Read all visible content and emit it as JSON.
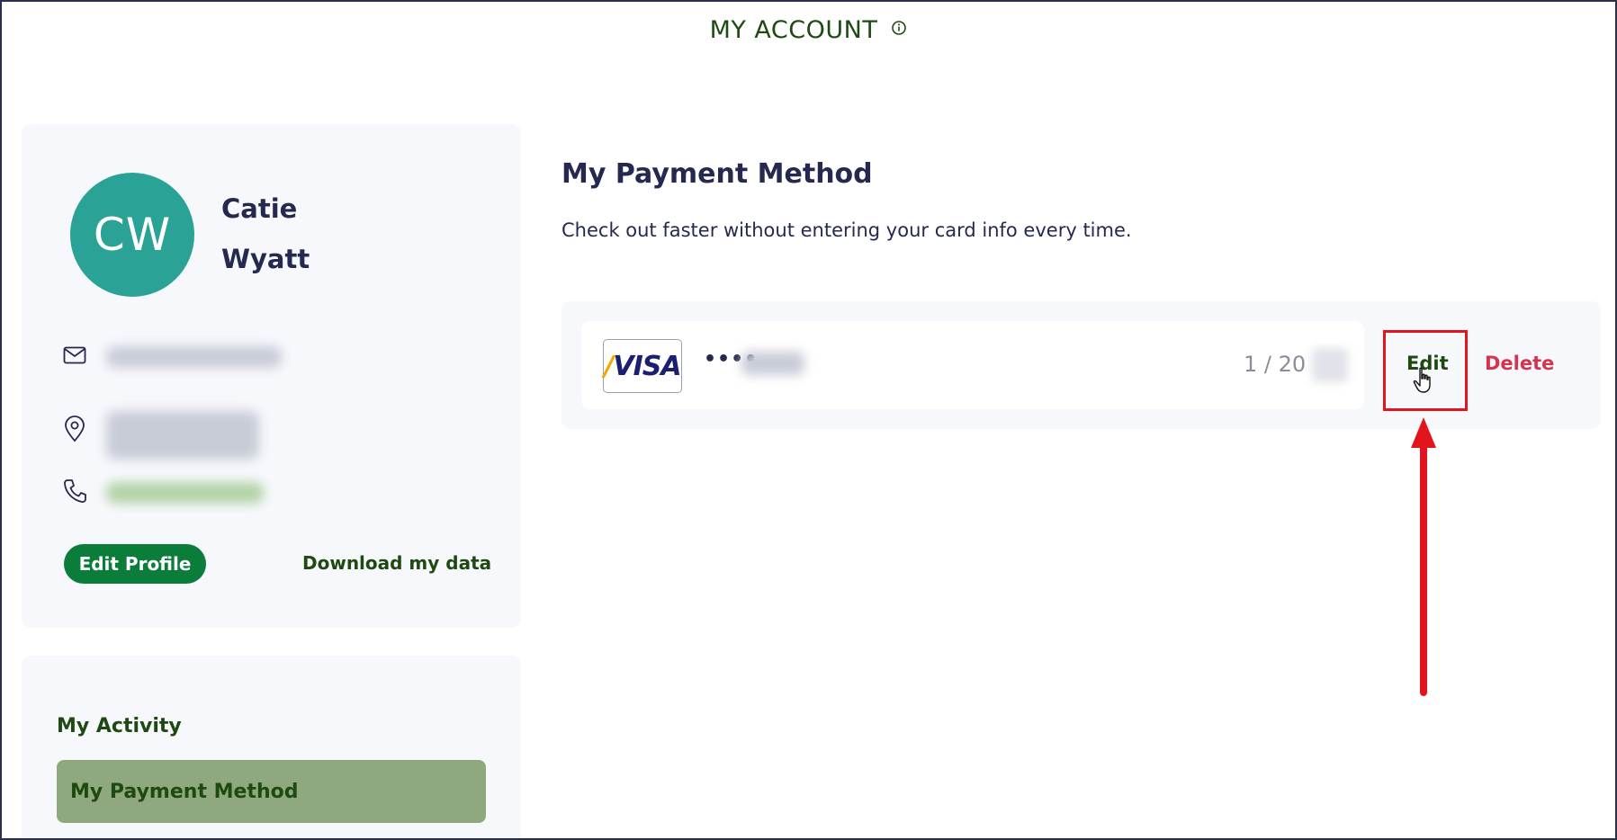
{
  "header": {
    "title": "MY ACCOUNT",
    "info_icon": "info-icon"
  },
  "profile": {
    "initials": "CW",
    "first_name": "Catie",
    "last_name": "Wyatt",
    "contact_icons": [
      "mail-icon",
      "location-pin-icon",
      "phone-icon"
    ],
    "edit_button": "Edit Profile",
    "download_link": "Download my data"
  },
  "nav": {
    "items": [
      {
        "label": "My Activity",
        "active": false
      },
      {
        "label": "My Payment Method",
        "active": true
      }
    ]
  },
  "main": {
    "title": "My Payment Method",
    "subtitle": "Check out faster without entering your card info every time.",
    "card": {
      "brand": "VISA",
      "masked_prefix": "••••",
      "expiry": "1 / 20",
      "edit_label": "Edit",
      "delete_label": "Delete"
    }
  },
  "annotation": {
    "highlight_color": "#e3151c",
    "cursor_icon": "hand-pointer-icon",
    "arrow_icon": "arrow-up-icon"
  },
  "colors": {
    "brand_green": "#0b7d3a",
    "text_navy": "#26294f",
    "nav_active_bg": "#8fa87e",
    "avatar_teal": "#2aa396",
    "delete_red": "#d6334f"
  }
}
